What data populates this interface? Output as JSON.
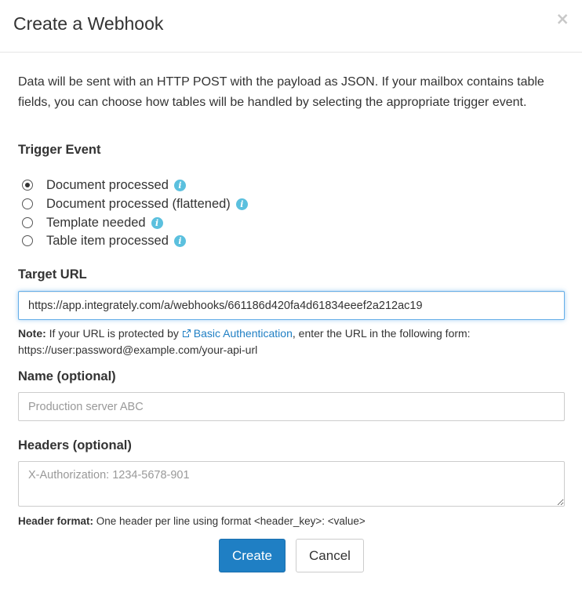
{
  "dialog": {
    "title": "Create a Webhook",
    "close_label": "×"
  },
  "intro_text": "Data will be sent with an HTTP POST with the payload as JSON. If your mailbox contains table fields, you can choose how tables will be handled by selecting the appropriate trigger event.",
  "trigger": {
    "label": "Trigger Event",
    "options": [
      {
        "label": "Document processed",
        "checked": true
      },
      {
        "label": "Document processed (flattened)",
        "checked": false
      },
      {
        "label": "Template needed",
        "checked": false
      },
      {
        "label": "Table item processed",
        "checked": false
      }
    ],
    "info_icon": "i"
  },
  "target_url": {
    "label": "Target URL",
    "value": "https://app.integrately.com/a/webhooks/661186d420fa4d61834eeef2a212ac19"
  },
  "note": {
    "prefix_bold": "Note:",
    "text_before_link": " If your URL is protected by ",
    "link_text": "Basic Authentication",
    "text_after_link": ", enter the URL in the following form:",
    "example": "https://user:password@example.com/your-api-url"
  },
  "name_field": {
    "label": "Name (optional)",
    "placeholder": "Production server ABC"
  },
  "headers_field": {
    "label": "Headers (optional)",
    "placeholder": "X-Authorization: 1234-5678-901"
  },
  "header_format": {
    "prefix_bold": "Header format:",
    "text": " One header per line using format <header_key>: <value>"
  },
  "buttons": {
    "create": "Create",
    "cancel": "Cancel"
  },
  "colors": {
    "primary": "#1f7fc4",
    "info": "#5bc0de",
    "focus_border": "#66afe9"
  }
}
